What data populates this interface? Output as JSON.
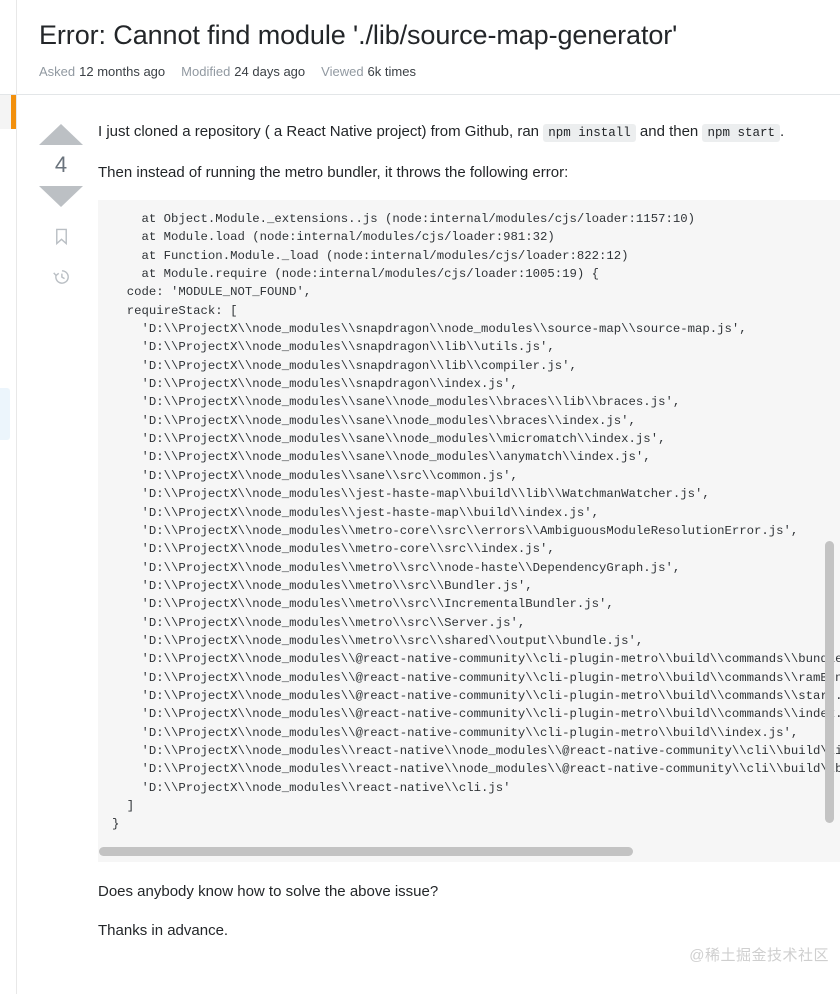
{
  "question": {
    "title": "Error: Cannot find module './lib/source-map-generator'",
    "meta": {
      "asked_label": "Asked",
      "asked_value": "12 months ago",
      "modified_label": "Modified",
      "modified_value": "24 days ago",
      "viewed_label": "Viewed",
      "viewed_value": "6k times"
    }
  },
  "votes": {
    "count": "4",
    "upvote_title": "Up vote",
    "downvote_title": "Down vote",
    "bookmark_title": "Save this question",
    "history_title": "Timeline"
  },
  "body": {
    "para1_a": "I just cloned a repository ( a React Native project) from Github, ran ",
    "para1_code1": "npm install",
    "para1_b": " and then ",
    "para1_code2": "npm start",
    "para1_c": ".",
    "para2": "Then instead of running the metro bundler, it throws the following error:",
    "para3": "Does anybody know how to solve the above issue?",
    "para4": "Thanks in advance.",
    "code": "    at Object.Module._extensions..js (node:internal/modules/cjs/loader:1157:10)\n    at Module.load (node:internal/modules/cjs/loader:981:32)\n    at Function.Module._load (node:internal/modules/cjs/loader:822:12)\n    at Module.require (node:internal/modules/cjs/loader:1005:19) {\n  code: 'MODULE_NOT_FOUND',\n  requireStack: [\n    'D:\\\\ProjectX\\\\node_modules\\\\snapdragon\\\\node_modules\\\\source-map\\\\source-map.js',\n    'D:\\\\ProjectX\\\\node_modules\\\\snapdragon\\\\lib\\\\utils.js',\n    'D:\\\\ProjectX\\\\node_modules\\\\snapdragon\\\\lib\\\\compiler.js',\n    'D:\\\\ProjectX\\\\node_modules\\\\snapdragon\\\\index.js',\n    'D:\\\\ProjectX\\\\node_modules\\\\sane\\\\node_modules\\\\braces\\\\lib\\\\braces.js',\n    'D:\\\\ProjectX\\\\node_modules\\\\sane\\\\node_modules\\\\braces\\\\index.js',\n    'D:\\\\ProjectX\\\\node_modules\\\\sane\\\\node_modules\\\\micromatch\\\\index.js',\n    'D:\\\\ProjectX\\\\node_modules\\\\sane\\\\node_modules\\\\anymatch\\\\index.js',\n    'D:\\\\ProjectX\\\\node_modules\\\\sane\\\\src\\\\common.js',\n    'D:\\\\ProjectX\\\\node_modules\\\\jest-haste-map\\\\build\\\\lib\\\\WatchmanWatcher.js',\n    'D:\\\\ProjectX\\\\node_modules\\\\jest-haste-map\\\\build\\\\index.js',\n    'D:\\\\ProjectX\\\\node_modules\\\\metro-core\\\\src\\\\errors\\\\AmbiguousModuleResolutionError.js',\n    'D:\\\\ProjectX\\\\node_modules\\\\metro-core\\\\src\\\\index.js',\n    'D:\\\\ProjectX\\\\node_modules\\\\metro\\\\src\\\\node-haste\\\\DependencyGraph.js',\n    'D:\\\\ProjectX\\\\node_modules\\\\metro\\\\src\\\\Bundler.js',\n    'D:\\\\ProjectX\\\\node_modules\\\\metro\\\\src\\\\IncrementalBundler.js',\n    'D:\\\\ProjectX\\\\node_modules\\\\metro\\\\src\\\\Server.js',\n    'D:\\\\ProjectX\\\\node_modules\\\\metro\\\\src\\\\shared\\\\output\\\\bundle.js',\n    'D:\\\\ProjectX\\\\node_modules\\\\@react-native-community\\\\cli-plugin-metro\\\\build\\\\commands\\\\bundle.js',\n    'D:\\\\ProjectX\\\\node_modules\\\\@react-native-community\\\\cli-plugin-metro\\\\build\\\\commands\\\\ramBundle.js',\n    'D:\\\\ProjectX\\\\node_modules\\\\@react-native-community\\\\cli-plugin-metro\\\\build\\\\commands\\\\start.js',\n    'D:\\\\ProjectX\\\\node_modules\\\\@react-native-community\\\\cli-plugin-metro\\\\build\\\\commands\\\\index.js',\n    'D:\\\\ProjectX\\\\node_modules\\\\@react-native-community\\\\cli-plugin-metro\\\\build\\\\index.js',\n    'D:\\\\ProjectX\\\\node_modules\\\\react-native\\\\node_modules\\\\@react-native-community\\\\cli\\\\build\\\\index.js',\n    'D:\\\\ProjectX\\\\node_modules\\\\react-native\\\\node_modules\\\\@react-native-community\\\\cli\\\\build\\\\bin.js',\n    'D:\\\\ProjectX\\\\node_modules\\\\react-native\\\\cli.js'\n  ]\n}"
  },
  "watermark": {
    "text": "@稀土掘金技术社区"
  },
  "colors": {
    "accent_orange": "#f2900d",
    "code_bg": "#f6f6f6",
    "text": "#232629",
    "muted": "#6a737c"
  }
}
